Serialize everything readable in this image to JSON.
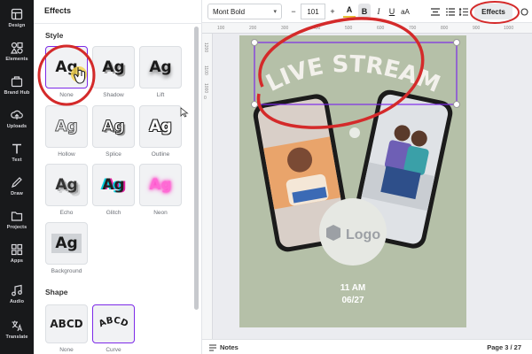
{
  "rail": [
    {
      "label": "Design",
      "icon": "design-icon"
    },
    {
      "label": "Elements",
      "icon": "elements-icon"
    },
    {
      "label": "Brand Hub",
      "icon": "brand-hub-icon"
    },
    {
      "label": "Uploads",
      "icon": "uploads-icon"
    },
    {
      "label": "Text",
      "icon": "text-icon"
    },
    {
      "label": "Draw",
      "icon": "draw-icon"
    },
    {
      "label": "Projects",
      "icon": "projects-icon"
    },
    {
      "label": "Apps",
      "icon": "apps-icon"
    },
    {
      "label": "Audio",
      "icon": "audio-icon"
    },
    {
      "label": "Translate",
      "icon": "translate-icon"
    }
  ],
  "panel": {
    "title": "Effects",
    "style_heading": "Style",
    "shape_heading": "Shape",
    "styles": [
      {
        "label": "None",
        "sample": "Ag"
      },
      {
        "label": "Shadow",
        "sample": "Ag"
      },
      {
        "label": "Lift",
        "sample": "Ag"
      },
      {
        "label": "Hollow",
        "sample": "Ag"
      },
      {
        "label": "Splice",
        "sample": "Ag"
      },
      {
        "label": "Outline",
        "sample": "Ag"
      },
      {
        "label": "Echo",
        "sample": "Ag"
      },
      {
        "label": "Glitch",
        "sample": "Ag"
      },
      {
        "label": "Neon",
        "sample": "Ag"
      },
      {
        "label": "Background",
        "sample": "Ag"
      }
    ],
    "shapes": [
      {
        "label": "None",
        "sample": "ABCD"
      },
      {
        "label": "Curve",
        "sample": "ABCD"
      }
    ]
  },
  "toolbar": {
    "font": "Mont Bold",
    "minus": "−",
    "size": "101",
    "plus": "+",
    "color_letter": "A",
    "bold": "B",
    "italic": "I",
    "underline": "U",
    "case": "aA",
    "effects": "Effects"
  },
  "ruler_top": [
    "100",
    "200",
    "300",
    "400",
    "500",
    "600",
    "700",
    "800",
    "900",
    "1000"
  ],
  "ruler_left": [
    "1200",
    "1100",
    "1000",
    "0"
  ],
  "design": {
    "headline": "LIVE STREAM",
    "logo": "Logo",
    "time": "11 AM",
    "date": "06/27"
  },
  "bottom": {
    "notes": "Notes",
    "page": "Page 3 / 27"
  },
  "colors": {
    "accent": "#7d2ae8",
    "annotation": "#d42a2a",
    "canvas_bg": "#b5c0a8",
    "rail_bg": "#18191b"
  }
}
